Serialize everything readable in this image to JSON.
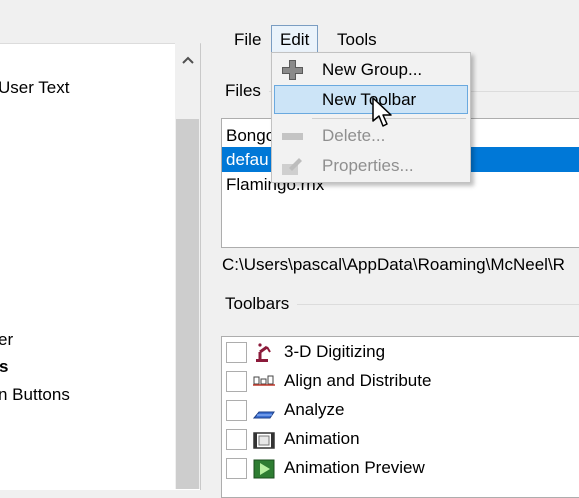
{
  "left_panel": {
    "items": [
      {
        "label": "User Text",
        "bold": false
      },
      {
        "label": "er",
        "bold": false
      },
      {
        "label": "s",
        "bold": true
      },
      {
        "label": "n Buttons",
        "bold": false
      }
    ]
  },
  "menubar": {
    "file": "File",
    "edit": "Edit",
    "tools": "Tools"
  },
  "files": {
    "group_label": "Files",
    "items": [
      "Bongo",
      "defau",
      "Flamingo.rhx"
    ],
    "selected_index": 1,
    "path": "C:\\Users\\pascal\\AppData\\Roaming\\McNeel\\R"
  },
  "toolbars": {
    "group_label": "Toolbars",
    "items": [
      {
        "label": "3-D Digitizing",
        "checked": false,
        "icon": "digitizer-arm-icon"
      },
      {
        "label": "Align and Distribute",
        "checked": false,
        "icon": "align-icon"
      },
      {
        "label": "Analyze",
        "checked": false,
        "icon": "analyze-icon"
      },
      {
        "label": "Animation",
        "checked": false,
        "icon": "film-icon"
      },
      {
        "label": "Animation Preview",
        "checked": false,
        "icon": "play-icon"
      }
    ]
  },
  "edit_menu": {
    "items": [
      {
        "label": "New Group...",
        "enabled": true,
        "icon": "plus-icon"
      },
      {
        "label": "New Toolbar",
        "enabled": true,
        "icon": "",
        "highlighted": true
      },
      {
        "label": "Delete...",
        "enabled": false,
        "icon": "minus-icon"
      },
      {
        "label": "Properties...",
        "enabled": false,
        "icon": "properties-icon"
      }
    ]
  },
  "colors": {
    "selection": "#0078d7",
    "menu_highlight": "#cce4f7",
    "disabled_text": "#8f8f8f"
  }
}
